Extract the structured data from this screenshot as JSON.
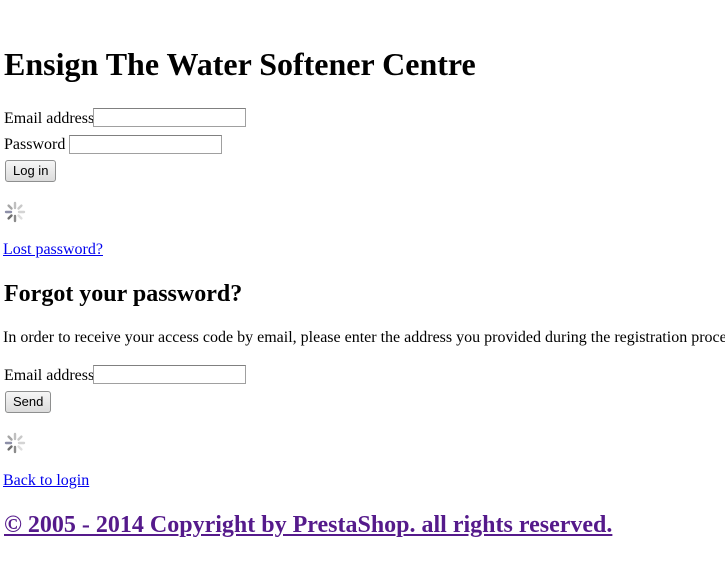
{
  "page": {
    "title": "Ensign The Water Softener Centre"
  },
  "login_form": {
    "email_label": "Email address",
    "email_value": "",
    "password_label": "Password",
    "password_value": "",
    "submit_label": "Log in",
    "lost_password_link": "Lost password?"
  },
  "forgot_form": {
    "heading": "Forgot your password?",
    "instructions": "In order to receive your access code by email, please enter the address you provided during the registration process.",
    "email_label": "Email address",
    "email_value": "",
    "submit_label": "Send",
    "back_link": "Back to login"
  },
  "footer": {
    "copyright": "© 2005 - 2014 Copyright by PrestaShop. all rights reserved."
  },
  "icons": {
    "loading": "spinner-icon"
  },
  "colors": {
    "link": "#0000ee",
    "visited_link": "#551a8b"
  }
}
